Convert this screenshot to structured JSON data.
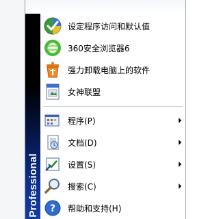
{
  "menu": {
    "sidebar_text": "Professional",
    "top_items": [
      {
        "label": "设定程序访问和默认值",
        "icon": "program-defaults-icon"
      },
      {
        "label": "360安全浏览器6",
        "icon": "360-browser-icon"
      },
      {
        "label": "强力卸载电脑上的软件",
        "icon": "uninstall-software-icon"
      },
      {
        "label": "女神联盟",
        "icon": "game-document-icon"
      }
    ],
    "main_items": [
      {
        "label": "程序(P)",
        "icon": "programs-icon",
        "submenu": true
      },
      {
        "label": "文档(D)",
        "icon": "documents-icon",
        "submenu": true
      },
      {
        "label": "设置(S)",
        "icon": "settings-icon",
        "submenu": true
      },
      {
        "label": "搜索(C)",
        "icon": "search-icon",
        "submenu": true
      },
      {
        "label": "帮助和支持(H)",
        "icon": "help-icon",
        "submenu": false
      }
    ]
  }
}
